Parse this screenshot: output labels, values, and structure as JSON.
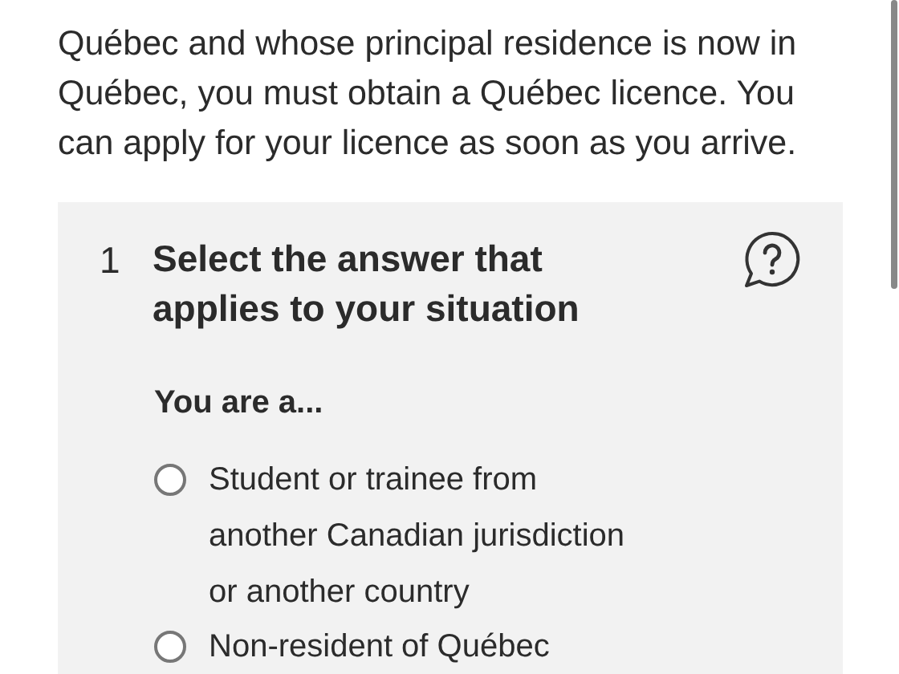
{
  "intro": {
    "text": "Québec and whose principal residence is now in\nQuébec, you must obtain a Québec licence. You\ncan apply for your licence as soon as you arrive."
  },
  "question": {
    "number": "1",
    "title": "Select the answer that\napplies to your situation",
    "prompt": "You are a...",
    "options": [
      {
        "label": "Student or trainee from\nanother Canadian jurisdiction\nor another country",
        "selected": false
      },
      {
        "label": "Non-resident of Québec",
        "selected": false
      }
    ]
  }
}
